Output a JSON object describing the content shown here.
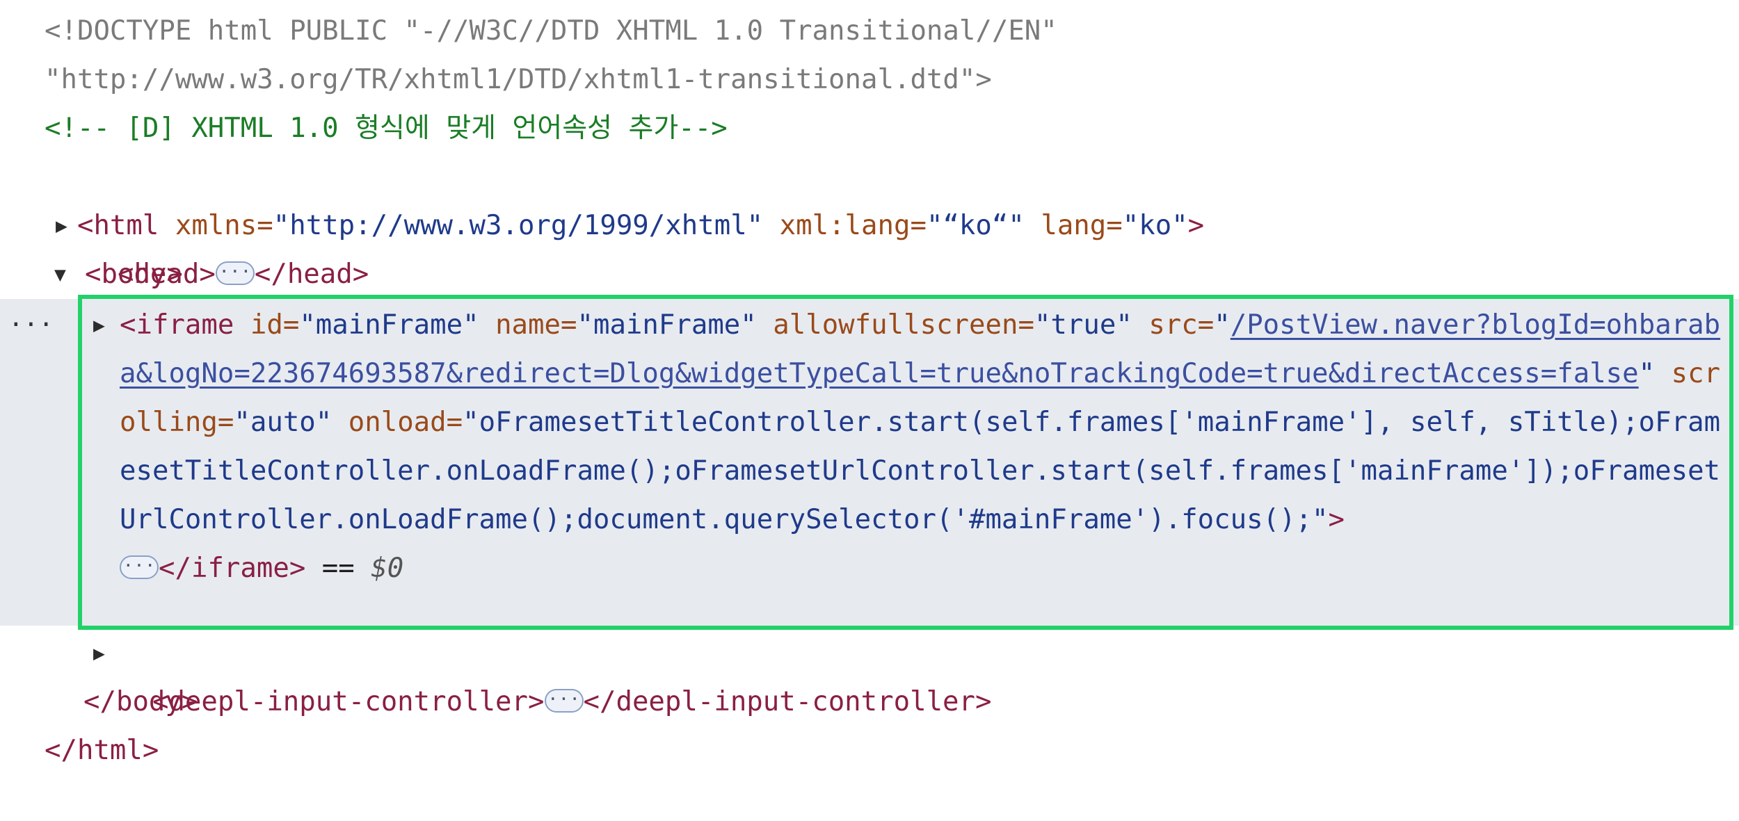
{
  "doctype": {
    "line1": "<!DOCTYPE html PUBLIC \"-//W3C//DTD XHTML 1.0 Transitional//EN\"",
    "line2": "\"http://www.w3.org/TR/xhtml1/DTD/xhtml1-transitional.dtd\">"
  },
  "comment": "<!-- [D] XHTML 1.0 형식에 맞게 언어속성 추가-->",
  "html_tag": {
    "open": "<html",
    "attr1_name": "xmlns=",
    "attr1_val": "\"http://www.w3.org/1999/xhtml\"",
    "attr2_name": "xml:lang=",
    "attr2_val": "\"“ko“\"",
    "attr3_name": "lang=",
    "attr3_val": "\"ko\"",
    "close": ">"
  },
  "head": {
    "open": "<head>",
    "close": "</head>",
    "ellipsis": "···"
  },
  "body_open": "<body>",
  "iframe": {
    "open": "<iframe",
    "id_name": "id=",
    "id_val": "\"mainFrame\"",
    "name_name": "name=",
    "name_val": "\"mainFrame\"",
    "allow_name": "allowfullscreen=",
    "allow_val": "\"true\"",
    "src_name": "src=",
    "src_quote_open": "\"",
    "src_link": "/PostView.naver?blogId=ohbaraba&logNo=223674693587&redirect=Dlog&widgetTypeCall=true&noTrackingCode=true&directAccess=false",
    "src_quote_close": "\"",
    "scrolling_name": "scrolling=",
    "scrolling_val": "\"auto\"",
    "onload_name": "onload=",
    "onload_val": "\"oFramesetTitleController.start(self.frames['mainFrame'], self, sTitle);oFramesetTitleController.onLoadFrame();oFramesetUrlController.start(self.frames['mainFrame']);oFramesetUrlController.onLoadFrame();document.querySelector('#mainFrame').focus();\"",
    "open_end": ">",
    "ellipsis": "···",
    "close": "</iframe>",
    "eq": " == ",
    "dollar": "$0"
  },
  "deepl": {
    "open": "<deepl-input-controller>",
    "close": "</deepl-input-controller>",
    "ellipsis": "···"
  },
  "body_close": "</body>",
  "html_close": "</html>",
  "row_dots": "···"
}
